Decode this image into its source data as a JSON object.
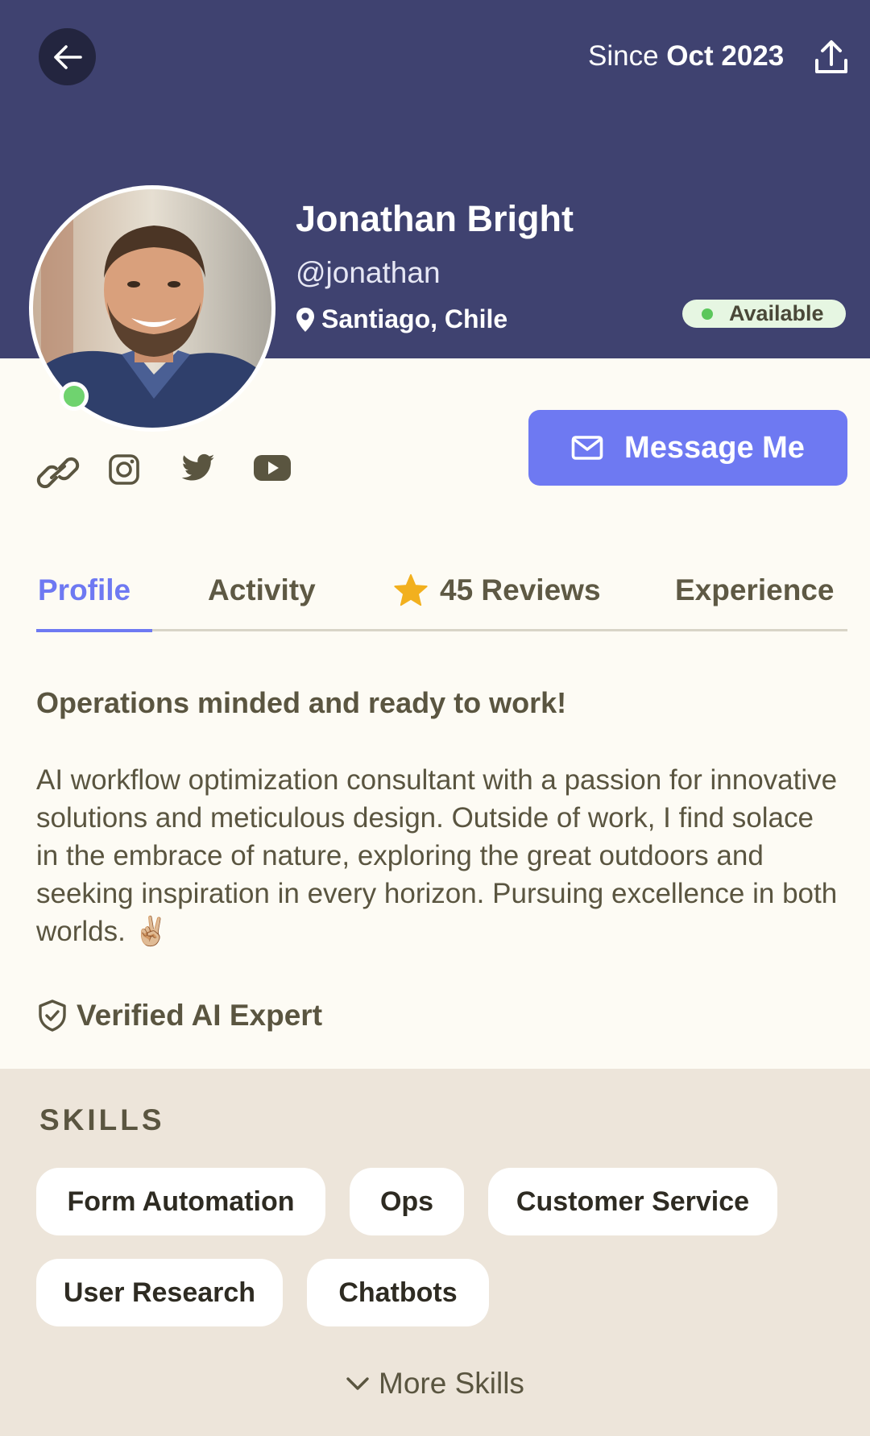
{
  "header": {
    "since_prefix": "Since",
    "since_date": "Oct 2023",
    "back_icon": "arrow-left-icon",
    "share_icon": "upload-icon"
  },
  "profile": {
    "name": "Jonathan Bright",
    "handle": "@jonathan",
    "location": "Santiago, Chile",
    "status": "Available",
    "online": true
  },
  "social_icons": [
    "link-icon",
    "instagram-icon",
    "twitter-icon",
    "youtube-icon"
  ],
  "actions": {
    "message_label": "Message Me"
  },
  "tabs": [
    {
      "label": "Profile",
      "active": true
    },
    {
      "label": "Activity",
      "active": false
    },
    {
      "label": "45 Reviews",
      "active": false,
      "icon": "star-icon"
    },
    {
      "label": "Experience",
      "active": false
    }
  ],
  "about": {
    "headline": "Operations minded and ready to work!",
    "bio": "AI workflow optimization consultant with a passion for innovative solutions and meticulous design. Outside of work, I find solace in the embrace of nature, exploring the great outdoors and seeking inspiration in every horizon. Pursuing excellence in both worlds. ✌🏼",
    "verified_label": "Verified AI Expert"
  },
  "skills": {
    "title": "SKILLS",
    "items": [
      "Form Automation",
      "Ops",
      "Customer Service",
      "User Research",
      "Chatbots"
    ],
    "more_label": "More Skills"
  },
  "colors": {
    "header_bg": "#3f4270",
    "accent": "#6e79f2",
    "page_bg": "#fdfbf4",
    "skills_bg": "#ede5da",
    "available_dot": "#5cc75c",
    "star": "#f2b01e"
  }
}
